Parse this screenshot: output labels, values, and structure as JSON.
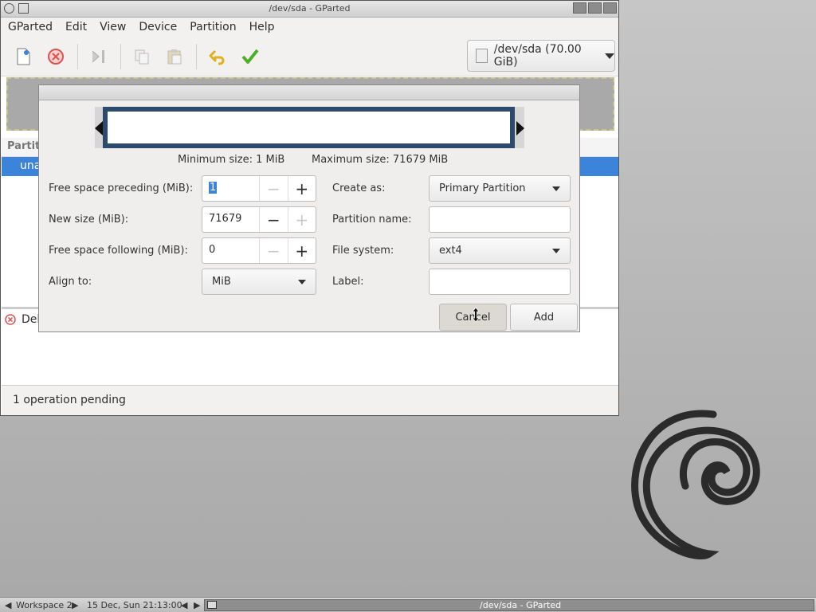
{
  "window": {
    "title": "/dev/sda - GParted",
    "menus": [
      "GParted",
      "Edit",
      "View",
      "Device",
      "Partition",
      "Help"
    ],
    "device_selector": "/dev/sda  (70.00 GiB)",
    "partition_list_header": "Partiti",
    "partition_row": "una",
    "operation_row": "Del",
    "status": "1 operation pending"
  },
  "dialog": {
    "min_size": "Minimum size: 1 MiB",
    "max_size": "Maximum size: 71679 MiB",
    "free_preceding_label": "Free space preceding (MiB):",
    "free_preceding_value": "1",
    "new_size_label": "New size (MiB):",
    "new_size_value": "71679",
    "free_following_label": "Free space following (MiB):",
    "free_following_value": "0",
    "align_label": "Align to:",
    "align_value": "MiB",
    "create_as_label": "Create as:",
    "create_as_value": "Primary Partition",
    "partition_name_label": "Partition name:",
    "partition_name_value": "",
    "filesystem_label": "File system:",
    "filesystem_value": "ext4",
    "label_label": "Label:",
    "label_value": "",
    "cancel": "Cancel",
    "add": "Add"
  },
  "taskbar": {
    "workspace": "Workspace 2",
    "datetime": "15 Dec, Sun 21:13:00",
    "task": "/dev/sda - GParted"
  },
  "colors": {
    "selection": "#3b84d9",
    "resize_bar_border": "#2c4a6b",
    "apply_green": "#4caf2a",
    "undo_yellow": "#e0b020",
    "delete_red": "#d9534f"
  }
}
